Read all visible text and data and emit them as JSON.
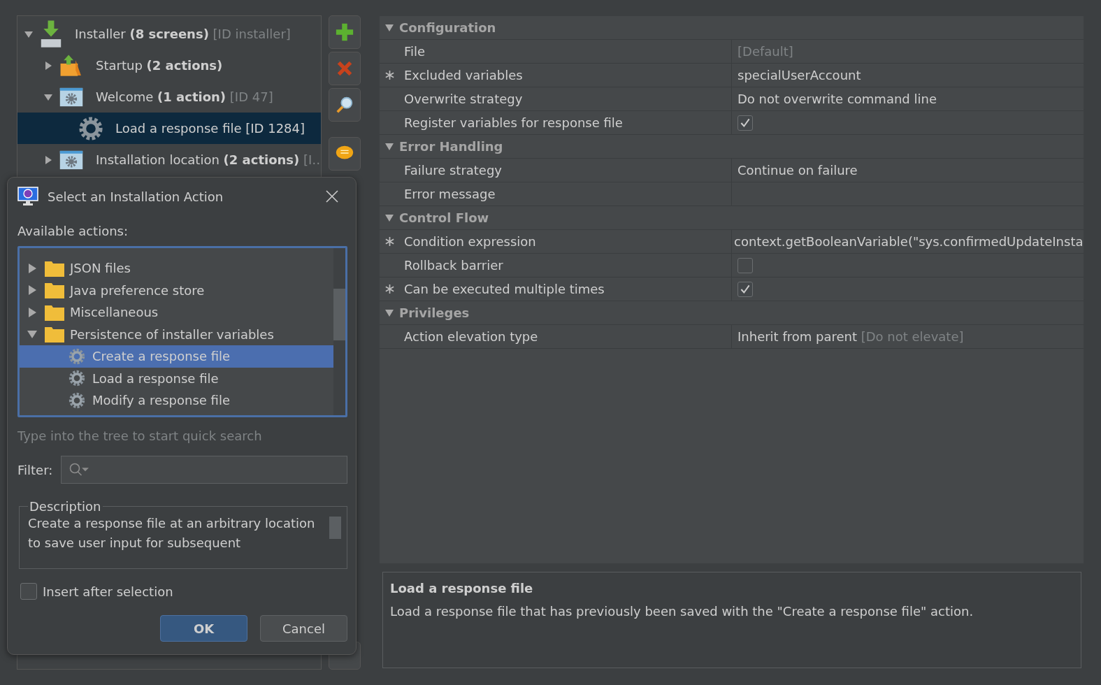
{
  "screens_tree": [
    {
      "kind": "installer",
      "name": "Installer",
      "count": "(8 screens)",
      "id": "[ID installer]",
      "expanded": true,
      "selected": false,
      "children": [
        {
          "kind": "startup",
          "name": "Startup",
          "count": "(2 actions)",
          "expanded": false,
          "selected": false
        },
        {
          "kind": "screen",
          "name": "Welcome",
          "count": "(1 action)",
          "id": "[ID 47]",
          "expanded": true,
          "selected": false,
          "children": [
            {
              "kind": "action",
              "name": "Load a response file [ID 1284]",
              "selected": true
            }
          ]
        },
        {
          "kind": "screen",
          "name": "Installation location",
          "count": "(2 actions)",
          "id": "[I…",
          "expanded": false,
          "selected": false
        }
      ]
    }
  ],
  "properties": [
    {
      "name": "Configuration",
      "expanded": true,
      "rows": [
        {
          "name": "File",
          "marked": false,
          "kind": "default",
          "value": "[Default]"
        },
        {
          "name": "Excluded variables",
          "marked": true,
          "kind": "text",
          "value": "specialUserAccount"
        },
        {
          "name": "Overwrite strategy",
          "marked": false,
          "kind": "text",
          "value": "Do not overwrite command line"
        },
        {
          "name": "Register variables for response file",
          "marked": false,
          "kind": "checkbox",
          "checked": true
        }
      ]
    },
    {
      "name": "Error Handling",
      "expanded": true,
      "rows": [
        {
          "name": "Failure strategy",
          "marked": false,
          "kind": "text",
          "value": "Continue on failure"
        },
        {
          "name": "Error message",
          "marked": false,
          "kind": "empty"
        }
      ]
    },
    {
      "name": "Control Flow",
      "expanded": true,
      "rows": [
        {
          "name": "Condition expression",
          "marked": true,
          "kind": "code",
          "value": "context.getBooleanVariable(\"sys.confirmedUpdateInsta"
        },
        {
          "name": "Rollback barrier",
          "marked": false,
          "kind": "checkbox",
          "checked": false
        },
        {
          "name": "Can be executed multiple times",
          "marked": true,
          "kind": "checkbox",
          "checked": true
        }
      ]
    },
    {
      "name": "Privileges",
      "expanded": true,
      "rows": [
        {
          "name": "Action elevation type",
          "marked": false,
          "kind": "text",
          "value": "Inherit from parent",
          "suffix": "[Do not elevate]"
        }
      ]
    }
  ],
  "help": {
    "title": "Load a response file",
    "text": "Load a response file that has previously been saved with the \"Create a response file\" action."
  },
  "dialog": {
    "title": "Select an Installation Action",
    "actions_label": "Available actions:",
    "actions": [
      {
        "kind": "folder",
        "name": "JSON files",
        "expanded": false,
        "selected": false
      },
      {
        "kind": "folder",
        "name": "Java preference store",
        "expanded": false,
        "selected": false
      },
      {
        "kind": "folder",
        "name": "Miscellaneous",
        "expanded": false,
        "selected": false
      },
      {
        "kind": "folder",
        "name": "Persistence of installer variables",
        "expanded": true,
        "selected": false,
        "children": [
          {
            "kind": "action",
            "name": "Create a response file",
            "selected": true
          },
          {
            "kind": "action",
            "name": "Load a response file",
            "selected": false
          },
          {
            "kind": "action",
            "name": "Modify a response file",
            "selected": false
          }
        ]
      }
    ],
    "hint": "Type into the tree to start quick search",
    "filter_label": "Filter:",
    "description_legend": "Description",
    "description": "Create a response file at an arbitrary location to save user input for subsequent",
    "insert_after": {
      "label": "Insert after selection",
      "checked": false
    },
    "buttons": [
      {
        "label": "OK",
        "default": true
      },
      {
        "label": "Cancel",
        "default": false
      }
    ]
  }
}
